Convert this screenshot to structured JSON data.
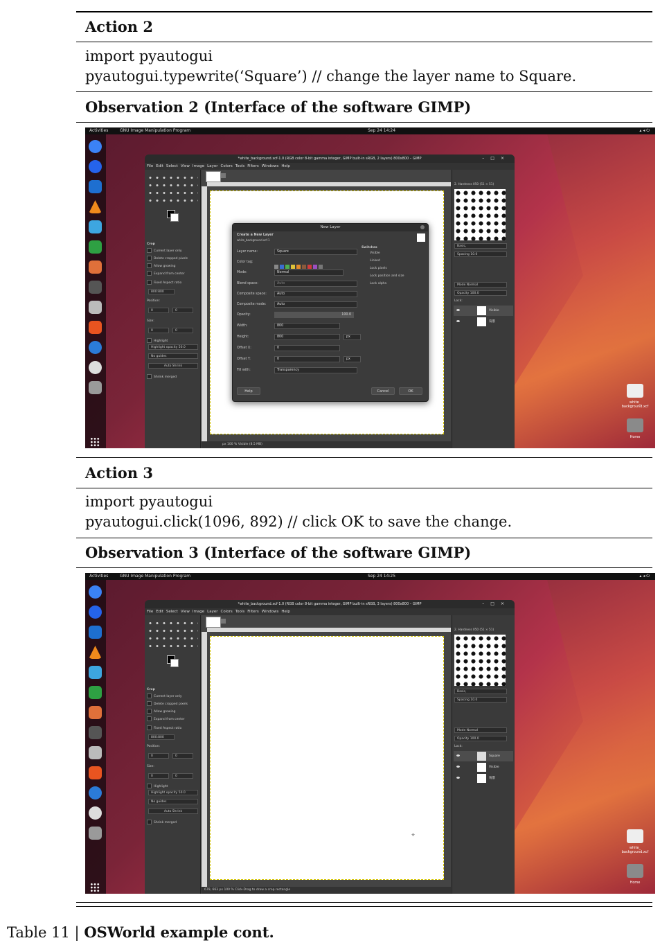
{
  "action2": {
    "heading": "Action 2",
    "line1": "import pyautogui",
    "line2": "pyautogui.typewrite(‘Square’) // change the layer name to Square."
  },
  "observation2": {
    "heading": "Observation 2 (Interface of the software GIMP)",
    "topbar": {
      "activities": "Activities",
      "app": "GNU Image Manipulation Program",
      "clock": "Sep 24  14:24"
    },
    "window_title": "*white_background.xcf-1.0 (RGB color 8-bit gamma integer, GIMP built-in sRGB, 2 layers) 800x800 – GIMP",
    "status": "Visible (8.5 MB)",
    "zoom": "100 %",
    "units": "px",
    "layers": [
      "Visible",
      "背景"
    ],
    "dialog": {
      "title": "New Layer",
      "subtitle": "Create a New Layer",
      "subtitle2": "white_background.xcf-1",
      "layer_name_label": "Layer name:",
      "layer_name_value": "Square",
      "color_tag_label": "Color tag:",
      "mode_label": "Mode:",
      "mode_value": "Normal",
      "blend_label": "Blend space:",
      "blend_value": "Auto",
      "composite_space_label": "Composite space:",
      "composite_space_value": "Auto",
      "composite_mode_label": "Composite mode:",
      "composite_mode_value": "Auto",
      "opacity_label": "Opacity:",
      "opacity_value": "100.0",
      "width_label": "Width:",
      "width_value": "800",
      "height_label": "Height:",
      "height_value": "800",
      "offx_label": "Offset X:",
      "offx_value": "0",
      "offy_label": "Offset Y:",
      "offy_value": "0",
      "fill_label": "Fill with:",
      "fill_value": "Transparency",
      "switches_label": "Switches",
      "switches": [
        "Visible",
        "Linked",
        "Lock pixels",
        "Lock position and size",
        "Lock alpha"
      ],
      "help": "Help",
      "cancel": "Cancel",
      "ok": "OK"
    }
  },
  "action3": {
    "heading": "Action 3",
    "line1": "import pyautogui",
    "line2": "pyautogui.click(1096, 892) // click OK to save the change."
  },
  "observation3": {
    "heading": "Observation 3 (Interface of the software GIMP)",
    "topbar": {
      "activities": "Activities",
      "app": "GNU Image Manipulation Program",
      "clock": "Sep 24  14:25"
    },
    "window_title": "*white_background.xcf-1.0 (RGB color 8-bit gamma integer, GIMP built-in sRGB, 3 layers) 800x800 – GIMP",
    "coords": "679, 663",
    "status": "Click-Drag to draw a crop rectangle",
    "zoom": "100 %",
    "units": "px",
    "layers": [
      "Square",
      "Visible",
      "背景"
    ]
  },
  "gimp_common": {
    "menu": [
      "File",
      "Edit",
      "Select",
      "View",
      "Image",
      "Layer",
      "Colors",
      "Tools",
      "Filters",
      "Windows",
      "Help"
    ],
    "crop_title": "Crop",
    "crop_options": [
      "Current layer only",
      "Delete cropped pixels",
      "Allow growing",
      "Expand from center"
    ],
    "fixed": "Fixed",
    "aspect": "Aspect ratio",
    "ratio": "800:800",
    "position": "Position:",
    "size": "Size:",
    "highlight": "Highlight",
    "highlight_opacity": "Highlight opacity",
    "highlight_value": "50.0",
    "guides": "No guides",
    "auto_shrink": "Auto Shrink",
    "shrink_merged": "Shrink merged",
    "brush_name": "2. Hardness 050 (51 × 51)",
    "brush_preset": "Basic,",
    "spacing": "Spacing",
    "spacing_value": "10.0",
    "mode": "Mode",
    "mode_value": "Normal",
    "opacity": "Opacity",
    "opacity_value": "100.0",
    "lock": "Lock:",
    "desktop_file": "white_ background.xcf",
    "home": "Home"
  },
  "caption": {
    "prefix": "Table 11 | ",
    "bold": "OSWorld example cont."
  }
}
